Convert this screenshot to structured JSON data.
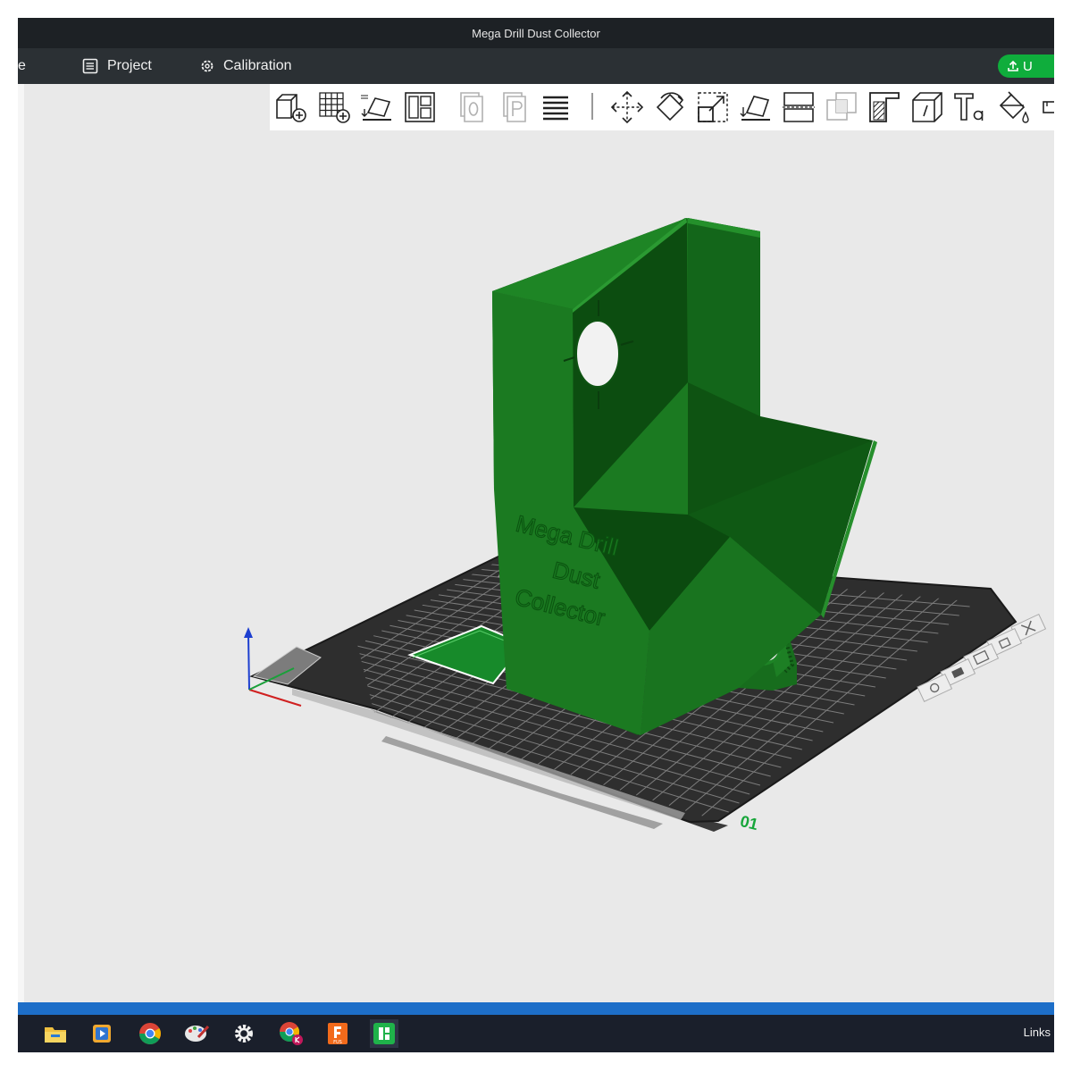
{
  "window": {
    "title": "Mega Drill Dust Collector"
  },
  "menubar": {
    "cut_text": "e",
    "project_label": "Project",
    "calibration_label": "Calibration",
    "upload_label": "U"
  },
  "model": {
    "text_lines": [
      "Mega Drill",
      "Dust",
      "Collector"
    ]
  },
  "plate": {
    "number": "01"
  },
  "taskbar": {
    "links_label": "Links",
    "fusion_badge": "FUS"
  },
  "colors": {
    "model_green": "#1a7a1f",
    "accent_green": "#0fad3c",
    "plate_dark": "#2a2a2a",
    "titlebar": "#1d2125"
  },
  "icons": {
    "toolbar": [
      "add-object-icon",
      "grid-add-icon",
      "auto-orient-icon",
      "arrange-icon",
      "object-plate-icon",
      "process-plate-icon",
      "layers-icon",
      "move-icon",
      "rotate-icon",
      "scale-icon",
      "lay-on-face-icon",
      "cut-icon",
      "boolean-icon",
      "support-paint-icon",
      "seam-paint-icon",
      "text-icon",
      "color-paint-icon"
    ],
    "taskbar": [
      "file-explorer-icon",
      "media-player-icon",
      "chrome-icon",
      "paint-icon",
      "settings-icon",
      "chrome-profile-icon",
      "fusion-icon",
      "bambu-studio-icon"
    ]
  }
}
